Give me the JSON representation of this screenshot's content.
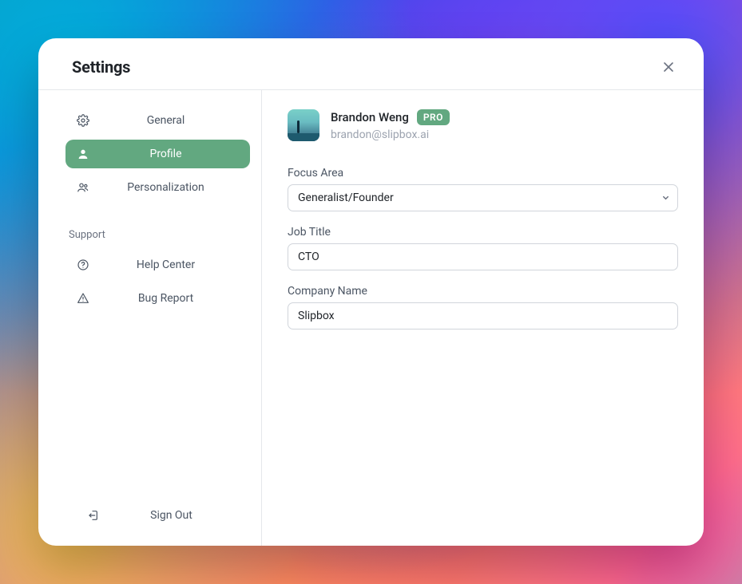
{
  "header": {
    "title": "Settings"
  },
  "sidebar": {
    "items": [
      {
        "label": "General"
      },
      {
        "label": "Profile"
      },
      {
        "label": "Personalization"
      }
    ],
    "support_heading": "Support",
    "support_items": [
      {
        "label": "Help Center"
      },
      {
        "label": "Bug Report"
      }
    ],
    "signout_label": "Sign Out"
  },
  "profile": {
    "user_name": "Brandon Weng",
    "badge": "PRO",
    "email": "brandon@slipbox.ai",
    "focus_area_label": "Focus Area",
    "focus_area_value": "Generalist/Founder",
    "job_title_label": "Job Title",
    "job_title_value": "CTO",
    "company_label": "Company Name",
    "company_value": "Slipbox"
  }
}
